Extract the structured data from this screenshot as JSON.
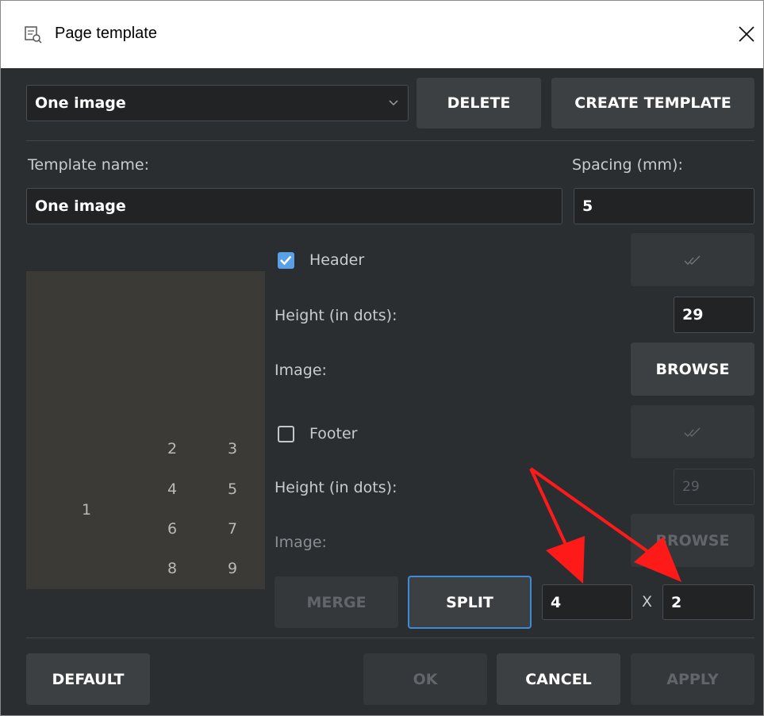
{
  "window": {
    "title": "Page template",
    "title_icon": "page-template-icon",
    "close_icon": "close-icon"
  },
  "template_select": {
    "value": "One image",
    "icon": "chevron-down-icon"
  },
  "actions": {
    "delete_label": "DELETE",
    "create_label": "CREATE TEMPLATE"
  },
  "template_name": {
    "label": "Template name:",
    "value": "One image"
  },
  "spacing": {
    "label": "Spacing (mm):",
    "value": "5"
  },
  "header": {
    "label": "Header",
    "checked": true,
    "height_label": "Height (in dots):",
    "height_value": "29",
    "image_label": "Image:",
    "browse_label": "BROWSE",
    "color_icon": "double-check-icon"
  },
  "footer": {
    "label": "Footer",
    "checked": false,
    "height_label": "Height (in dots):",
    "height_value": "29",
    "image_label": "Image:",
    "browse_label": "BROWSE",
    "color_icon": "double-check-icon"
  },
  "preview": {
    "cells": [
      "1",
      "2",
      "3",
      "4",
      "5",
      "6",
      "7",
      "8",
      "9"
    ]
  },
  "grid": {
    "merge_label": "MERGE",
    "split_label": "SPLIT",
    "rows": "4",
    "separator": "X",
    "cols": "2"
  },
  "footer_buttons": {
    "default_label": "DEFAULT",
    "ok_label": "OK",
    "cancel_label": "CANCEL",
    "apply_label": "APPLY"
  },
  "colors": {
    "background": "#2b2e31",
    "accent": "#3d8bd6",
    "annotation": "#ff0000"
  }
}
